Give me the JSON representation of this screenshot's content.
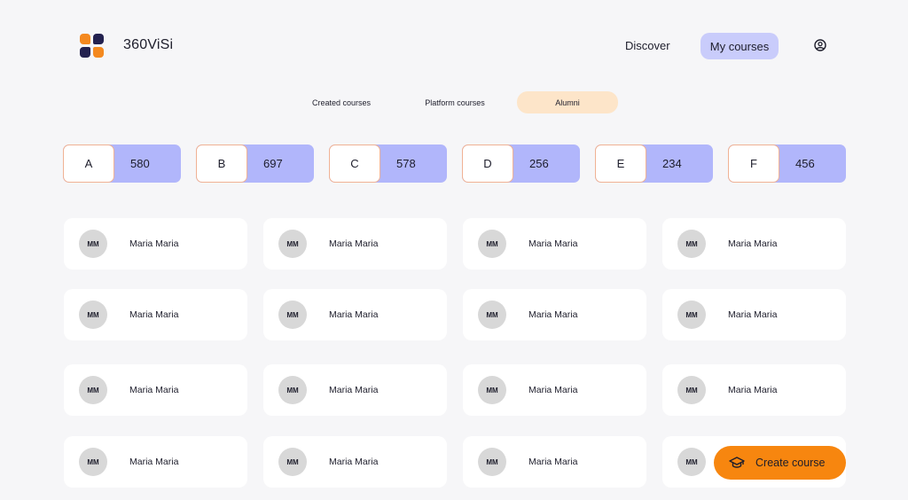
{
  "header": {
    "brand": "360ViSi",
    "nav": {
      "discover": "Discover",
      "my_courses": "My courses"
    }
  },
  "tabs": [
    {
      "label": "Created courses",
      "active": false
    },
    {
      "label": "Platform courses",
      "active": false
    },
    {
      "label": "Alumni",
      "active": true
    }
  ],
  "stats": [
    {
      "letter": "A",
      "value": "580"
    },
    {
      "letter": "B",
      "value": "697"
    },
    {
      "letter": "C",
      "value": "578"
    },
    {
      "letter": "D",
      "value": "256"
    },
    {
      "letter": "E",
      "value": "234"
    },
    {
      "letter": "F",
      "value": "456"
    }
  ],
  "alumni": [
    {
      "initials": "MM",
      "name": "Maria Maria"
    },
    {
      "initials": "MM",
      "name": "Maria Maria"
    },
    {
      "initials": "MM",
      "name": "Maria Maria"
    },
    {
      "initials": "MM",
      "name": "Maria Maria"
    },
    {
      "initials": "MM",
      "name": "Maria Maria"
    },
    {
      "initials": "MM",
      "name": "Maria Maria"
    },
    {
      "initials": "MM",
      "name": "Maria Maria"
    },
    {
      "initials": "MM",
      "name": "Maria Maria"
    },
    {
      "initials": "MM",
      "name": "Maria Maria"
    },
    {
      "initials": "MM",
      "name": "Maria Maria"
    },
    {
      "initials": "MM",
      "name": "Maria Maria"
    },
    {
      "initials": "MM",
      "name": "Maria Maria"
    },
    {
      "initials": "MM",
      "name": "Maria Maria"
    },
    {
      "initials": "MM",
      "name": "Maria Maria"
    },
    {
      "initials": "MM",
      "name": "Maria Maria"
    },
    {
      "initials": "MM"
    }
  ],
  "fab": {
    "label": "Create course",
    "icon": "graduation-cap-icon"
  },
  "icons": {
    "user": "user-circle-icon",
    "logo": "logo-icon"
  },
  "colors": {
    "accent": "#c9ccfb",
    "stat_bg": "#b1b6fb",
    "active_tab": "#fde5c9",
    "fab": "#f7860f"
  }
}
